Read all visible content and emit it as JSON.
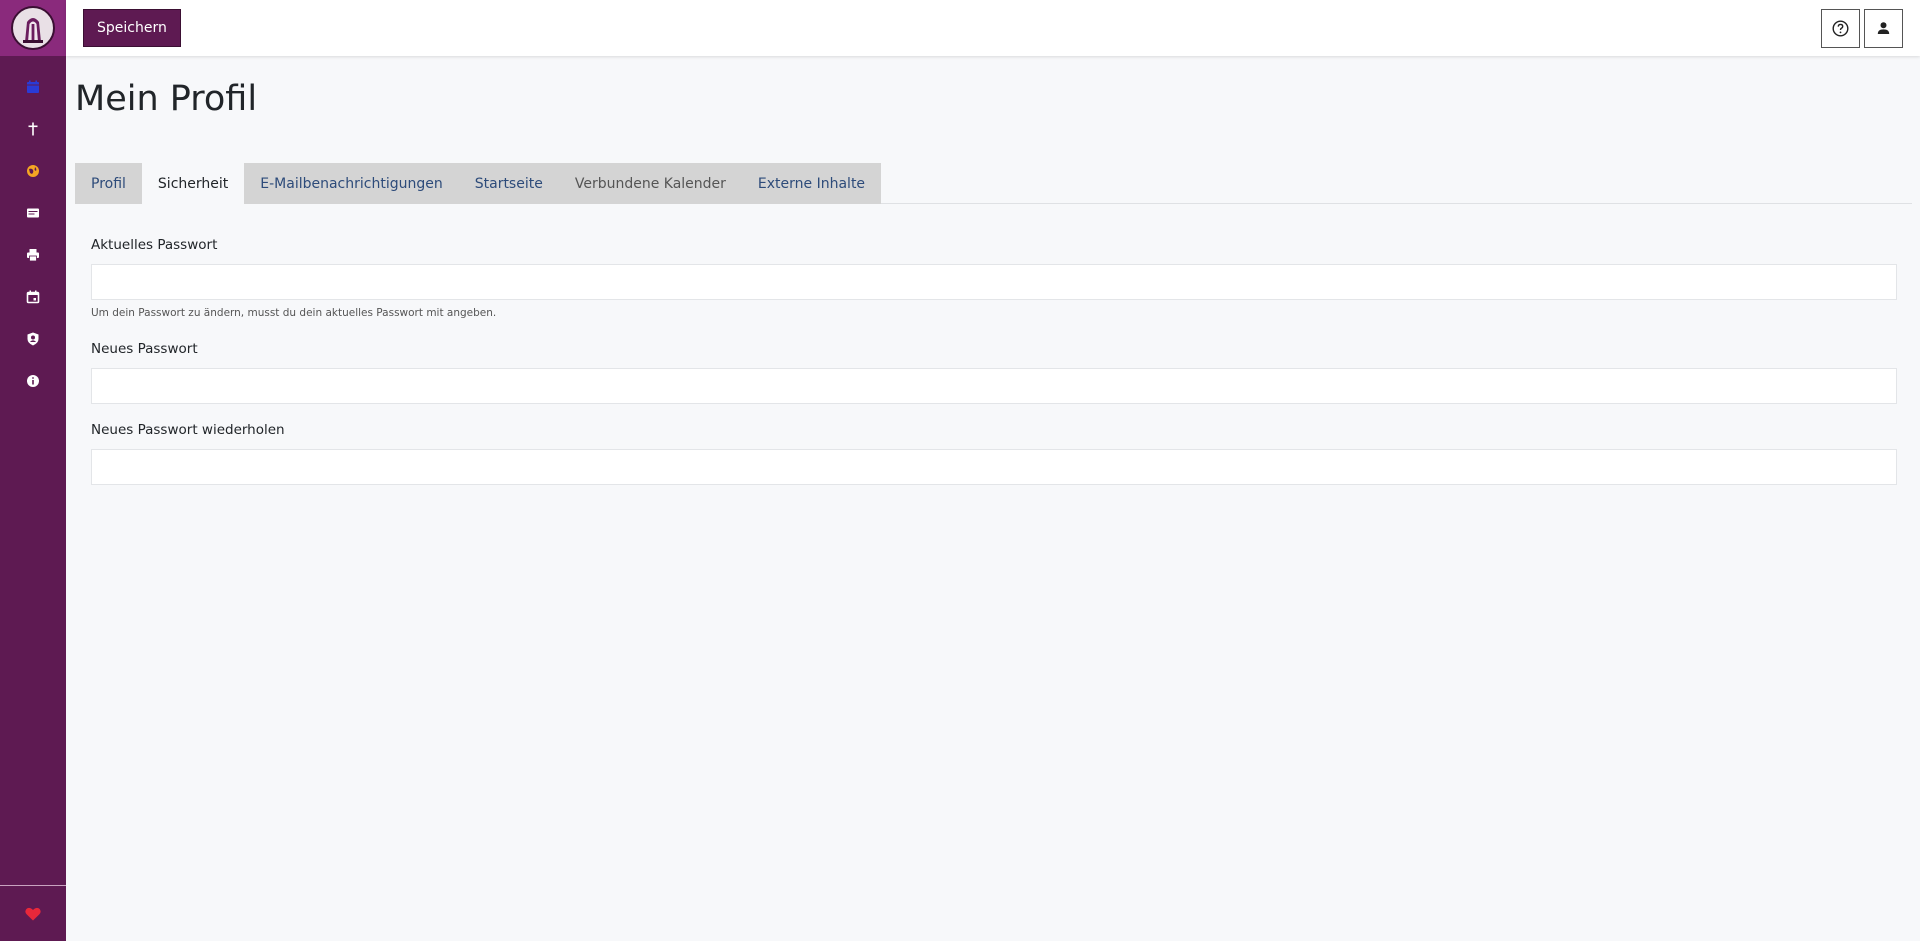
{
  "colors": {
    "sidebar": "#5e1a52",
    "logo_bg": "#8a2a7c",
    "primary_button": "#5e1a52",
    "tab_inactive_bg": "#d4d4d4",
    "tab_link": "#2d4b7a",
    "page_bg": "#f7f8fa"
  },
  "sidebar": {
    "logo": "app-logo",
    "items": [
      {
        "icon": "calendar-icon",
        "color": "#2a3bd6"
      },
      {
        "icon": "cross-icon",
        "color": "#ffffff"
      },
      {
        "icon": "globe-icon",
        "color": "#f5a623"
      },
      {
        "icon": "id-card-icon",
        "color": "#ffffff"
      },
      {
        "icon": "printer-icon",
        "color": "#ffffff"
      },
      {
        "icon": "calendar-outline-icon",
        "color": "#ffffff"
      },
      {
        "icon": "user-shield-icon",
        "color": "#ffffff"
      },
      {
        "icon": "info-icon",
        "color": "#ffffff"
      }
    ],
    "bottom_icon": "heart-icon"
  },
  "toolbar": {
    "save_label": "Speichern",
    "help_icon": "help-icon",
    "user_icon": "user-icon"
  },
  "page": {
    "title": "Mein Profil"
  },
  "tabs": [
    {
      "label": "Profil",
      "active": false
    },
    {
      "label": "Sicherheit",
      "active": true
    },
    {
      "label": "E-Mailbenachrichtigungen",
      "active": false
    },
    {
      "label": "Startseite",
      "active": false
    },
    {
      "label": "Verbundene Kalender",
      "active": false
    },
    {
      "label": "Externe Inhalte",
      "active": false
    }
  ],
  "form": {
    "current_password": {
      "label": "Aktuelles Passwort",
      "value": "",
      "help": "Um dein Passwort zu ändern, musst du dein aktuelles Passwort mit angeben."
    },
    "new_password": {
      "label": "Neues Passwort",
      "value": ""
    },
    "repeat_password": {
      "label": "Neues Passwort wiederholen",
      "value": ""
    }
  }
}
